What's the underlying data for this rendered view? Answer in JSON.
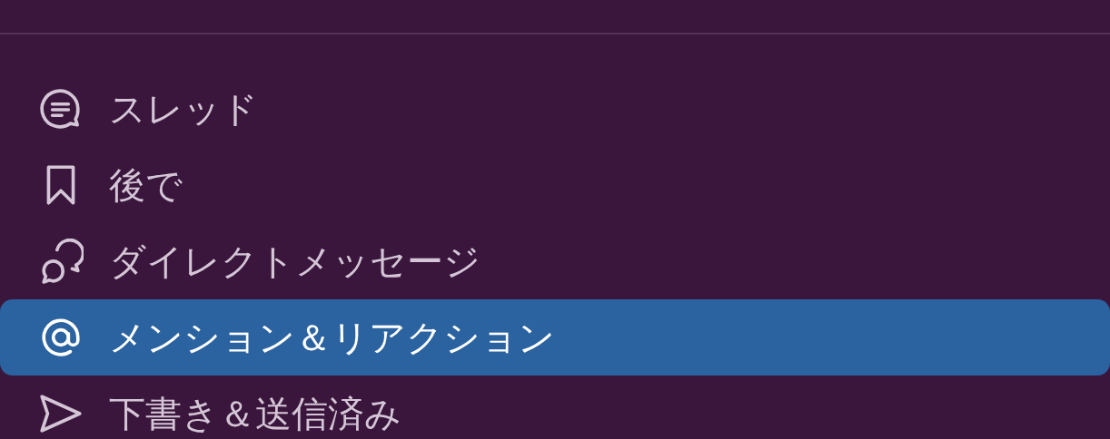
{
  "sidebar": {
    "items": [
      {
        "label": "スレッド",
        "kind": "threads",
        "selected": false
      },
      {
        "label": "後で",
        "kind": "later",
        "selected": false
      },
      {
        "label": "ダイレクトメッセージ",
        "kind": "dms",
        "selected": false
      },
      {
        "label": "メンション＆リアクション",
        "kind": "mentions",
        "selected": true
      },
      {
        "label": "下書き＆送信済み",
        "kind": "drafts",
        "selected": false
      }
    ]
  }
}
